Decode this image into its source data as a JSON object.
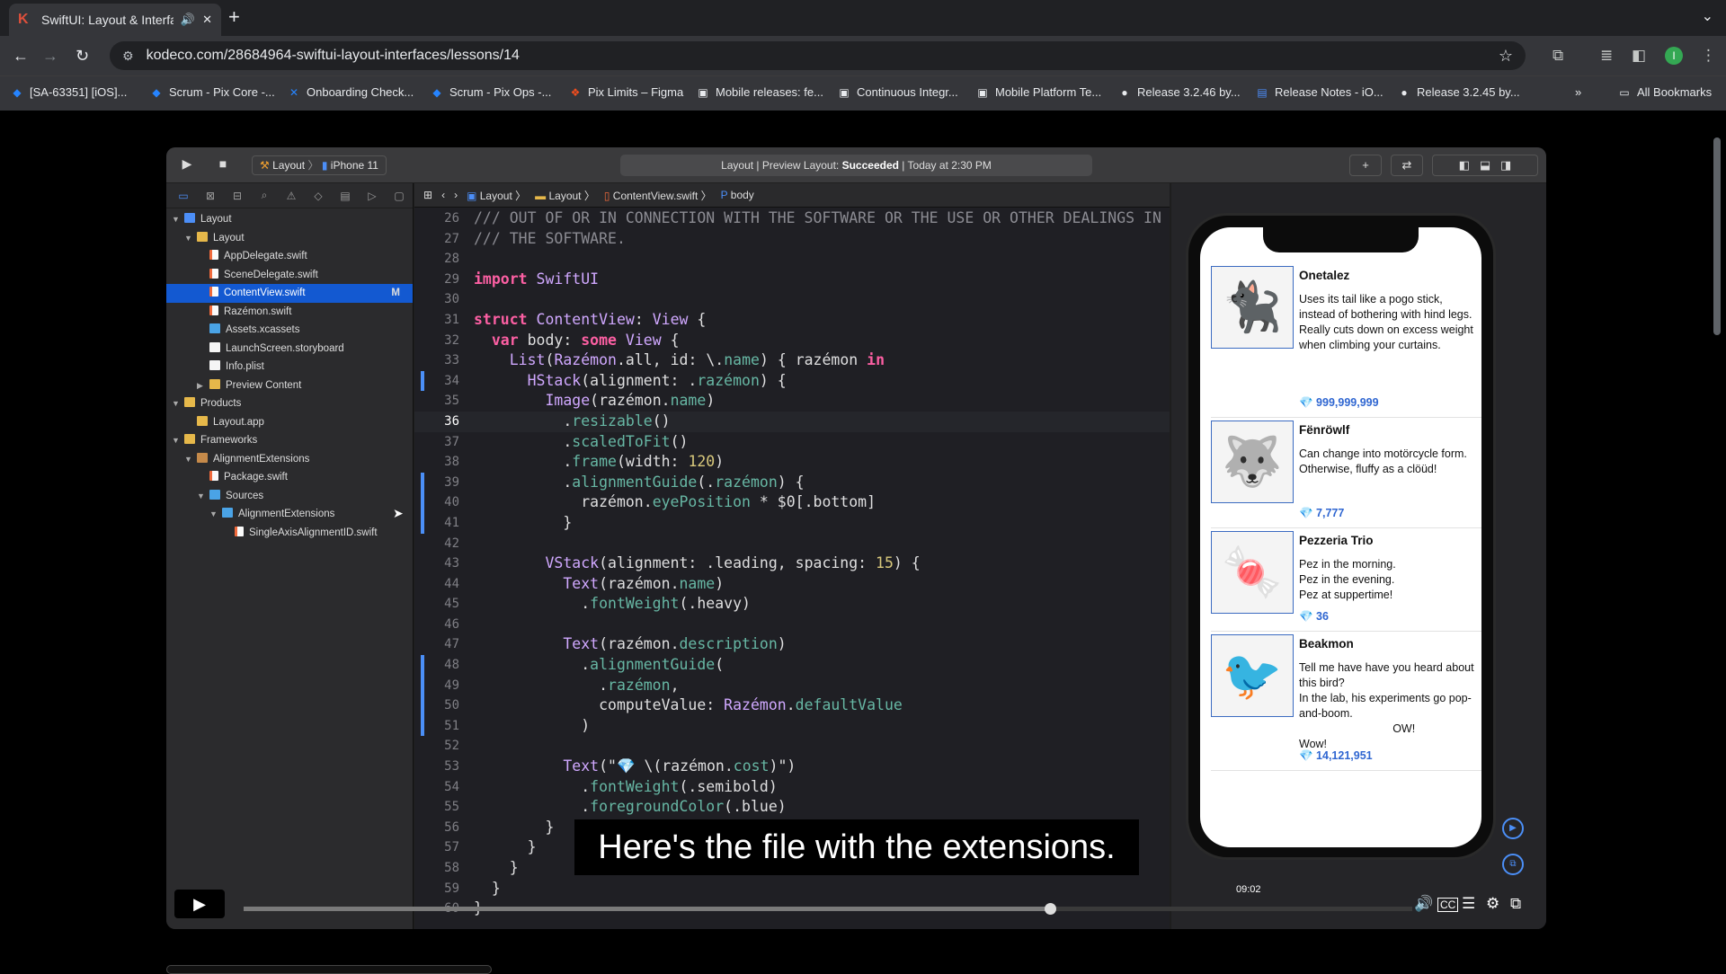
{
  "browser": {
    "tab_title": "SwiftUI: Layout & Interfac",
    "url": "kodeco.com/28684964-swiftui-layout-interfaces/lessons/14",
    "bookmarks": [
      {
        "label": "[SA-63351] [iOS]...",
        "icon": "jira-icon",
        "color": "#2684ff"
      },
      {
        "label": "Scrum - Pix Core -...",
        "icon": "jira-icon",
        "color": "#2684ff"
      },
      {
        "label": "Onboarding Check...",
        "icon": "confluence-icon",
        "color": "#2684ff"
      },
      {
        "label": "Scrum - Pix Ops -...",
        "icon": "jira-icon",
        "color": "#2684ff"
      },
      {
        "label": "Pix Limits – Figma",
        "icon": "figma-icon",
        "color": "#f24e1e"
      },
      {
        "label": "Mobile releases: fe...",
        "icon": "app-icon",
        "color": "#e8eaed"
      },
      {
        "label": "Continuous Integr...",
        "icon": "app-icon",
        "color": "#e8eaed"
      },
      {
        "label": "Mobile Platform Te...",
        "icon": "app-icon",
        "color": "#e8eaed"
      },
      {
        "label": "Release 3.2.46 by...",
        "icon": "github-icon",
        "color": "#e8eaed"
      },
      {
        "label": "Release Notes - iO...",
        "icon": "doc-icon",
        "color": "#4c8bf5"
      },
      {
        "label": "Release 3.2.45 by...",
        "icon": "github-icon",
        "color": "#e8eaed"
      }
    ],
    "more_bookmarks": "»",
    "all_bookmarks": "All Bookmarks",
    "profile_initial": "I"
  },
  "xcode": {
    "scheme_target": "Layout",
    "scheme_device": "iPhone 11",
    "activity_prefix": "Layout | Preview Layout: ",
    "activity_status": "Succeeded",
    "activity_suffix": " | Today at 2:30 PM",
    "jump_bar": [
      "Layout",
      "Layout",
      "ContentView.swift",
      "body"
    ],
    "navigator": [
      {
        "label": "Layout",
        "level": 0,
        "type": "project",
        "expanded": true
      },
      {
        "label": "Layout",
        "level": 1,
        "type": "folder",
        "expanded": true
      },
      {
        "label": "AppDelegate.swift",
        "level": 2,
        "type": "swift"
      },
      {
        "label": "SceneDelegate.swift",
        "level": 2,
        "type": "swift"
      },
      {
        "label": "ContentView.swift",
        "level": 2,
        "type": "swift",
        "selected": true,
        "badge": "M"
      },
      {
        "label": "Razémon.swift",
        "level": 2,
        "type": "swift"
      },
      {
        "label": "Assets.xcassets",
        "level": 2,
        "type": "assets"
      },
      {
        "label": "LaunchScreen.storyboard",
        "level": 2,
        "type": "storyboard"
      },
      {
        "label": "Info.plist",
        "level": 2,
        "type": "plist"
      },
      {
        "label": "Preview Content",
        "level": 2,
        "type": "folder",
        "expanded": false
      },
      {
        "label": "Products",
        "level": 0,
        "type": "folder",
        "expanded": true
      },
      {
        "label": "Layout.app",
        "level": 1,
        "type": "app"
      },
      {
        "label": "Frameworks",
        "level": 0,
        "type": "folder",
        "expanded": true
      },
      {
        "label": "AlignmentExtensions",
        "level": 1,
        "type": "package",
        "expanded": true
      },
      {
        "label": "Package.swift",
        "level": 2,
        "type": "swift"
      },
      {
        "label": "Sources",
        "level": 2,
        "type": "bluefolder",
        "expanded": true
      },
      {
        "label": "AlignmentExtensions",
        "level": 3,
        "type": "bluefolder",
        "expanded": true
      },
      {
        "label": "SingleAxisAlignmentID.swift",
        "level": 4,
        "type": "swift"
      }
    ],
    "code_lines": [
      {
        "n": "26",
        "t": "/// OUT OF OR IN CONNECTION WITH THE SOFTWARE OR THE USE OR OTHER DEALINGS IN"
      },
      {
        "n": "27",
        "t": "/// THE SOFTWARE."
      },
      {
        "n": "28",
        "t": ""
      },
      {
        "n": "29",
        "t": "import SwiftUI"
      },
      {
        "n": "30",
        "t": ""
      },
      {
        "n": "31",
        "t": "struct ContentView: View {"
      },
      {
        "n": "32",
        "t": "  var body: some View {"
      },
      {
        "n": "33",
        "t": "    List(Razémon.all, id: \\.name) { razémon in"
      },
      {
        "n": "34",
        "t": "      HStack(alignment: .razémon) {",
        "changed": true
      },
      {
        "n": "35",
        "t": "        Image(razémon.name)"
      },
      {
        "n": "36",
        "t": "          .resizable()",
        "current": true
      },
      {
        "n": "37",
        "t": "          .scaledToFit()"
      },
      {
        "n": "38",
        "t": "          .frame(width: 120)"
      },
      {
        "n": "39",
        "t": "          .alignmentGuide(.razémon) {",
        "changed": true
      },
      {
        "n": "40",
        "t": "            razémon.eyePosition * $0[.bottom]",
        "changed": true
      },
      {
        "n": "41",
        "t": "          }",
        "changed": true
      },
      {
        "n": "42",
        "t": ""
      },
      {
        "n": "43",
        "t": "        VStack(alignment: .leading, spacing: 15) {"
      },
      {
        "n": "44",
        "t": "          Text(razémon.name)"
      },
      {
        "n": "45",
        "t": "            .fontWeight(.heavy)"
      },
      {
        "n": "46",
        "t": ""
      },
      {
        "n": "47",
        "t": "          Text(razémon.description)"
      },
      {
        "n": "48",
        "t": "            .alignmentGuide(",
        "changed": true
      },
      {
        "n": "49",
        "t": "              .razémon,",
        "changed": true
      },
      {
        "n": "50",
        "t": "              computeValue: Razémon.defaultValue",
        "changed": true
      },
      {
        "n": "51",
        "t": "            )",
        "changed": true
      },
      {
        "n": "52",
        "t": ""
      },
      {
        "n": "53",
        "t": "          Text(\"💎 \\(razémon.cost)\")"
      },
      {
        "n": "54",
        "t": "            .fontWeight(.semibold)"
      },
      {
        "n": "55",
        "t": "            .foregroundColor(.blue)"
      },
      {
        "n": "56",
        "t": "        }"
      },
      {
        "n": "57",
        "t": "      }"
      },
      {
        "n": "58",
        "t": "    }"
      },
      {
        "n": "59",
        "t": "  }"
      },
      {
        "n": "60",
        "t": "}"
      }
    ],
    "preview_rows": [
      {
        "name": "Onetalez",
        "description": "Uses its tail like a pogo stick, instead of bothering with hind legs.\nReally cuts down on excess weight when climbing your curtains.",
        "cost": "💎 999,999,999",
        "icon": "black-cat-icon"
      },
      {
        "name": "Fënröwlf",
        "description": "Can change into motörcycle form.\nOtherwise, fluffy as a clöüd!",
        "cost": "💎 7,777",
        "icon": "wolf-icon"
      },
      {
        "name": "Pezzeria Trio",
        "description": "Pez in the morning.\nPez in the evening.\nPez at suppertime!",
        "cost": "💎 36",
        "icon": "pez-dispensers-icon"
      },
      {
        "name": "Beakmon",
        "description": "Tell me have have you heard about this bird?\nIn the lab, his experiments go pop-and-boom.\n                              OW!\nWow!",
        "cost": "💎 14,121,951",
        "icon": "bird-scientist-icon"
      }
    ]
  },
  "video": {
    "caption": "Here's the file with the extensions.",
    "timestamp": "09:02",
    "progress": 0.69
  }
}
